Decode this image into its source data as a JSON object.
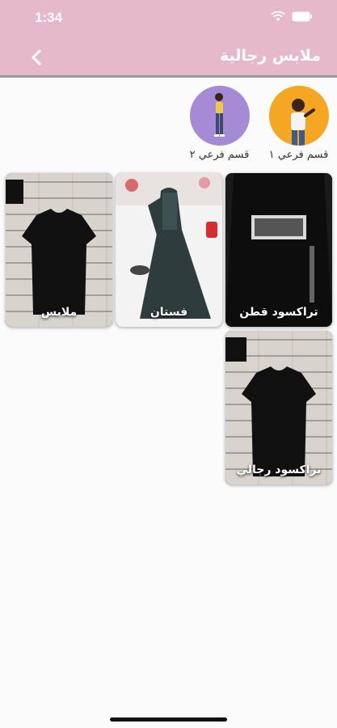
{
  "status": {
    "time": "1:34"
  },
  "header": {
    "title": "ملابس رجالية"
  },
  "subcategories": [
    {
      "label": "قسم فرعي ١",
      "color": "#f5a623"
    },
    {
      "label": "قسم فرعي ٢",
      "color": "#a58bd6"
    }
  ],
  "products": [
    {
      "label": "تراكسود قطن"
    },
    {
      "label": "فستان"
    },
    {
      "label": "ملابس"
    },
    {
      "label": "تراكسود رجالي"
    }
  ],
  "colors": {
    "accent": "#e6b9ca",
    "background": "#fbfbfb"
  }
}
